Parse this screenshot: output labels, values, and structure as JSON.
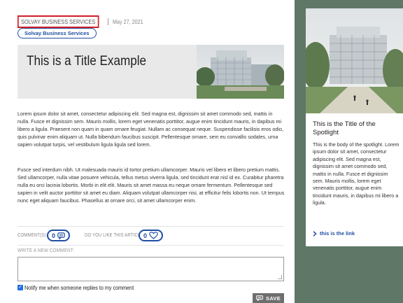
{
  "article": {
    "source": "SOLVAY BUSINESS SERVICES",
    "date": "May 27, 2021",
    "tag": "Solvay Business Services",
    "title": "This is a Title Example",
    "paragraph1": "Lorem ipsum dolor sit amet, consectetur adipiscing elit. Sed magna est, dignissim sit amet commodo sed, mattis in nulla. Fusce et dignissim sem. Mauris mollis, lorem eget venenatis porttitor, augue enim tincidunt mauris, in dapibus mi libero a ligula. Praesent non quam in quam ornare feugiat. Nullam ac consequat neque. Suspendisse facilisis eros odio, quis pulvinar enim aliquam ut. Nulla bibendum faucibus suscipit. Pellentesque ornare, sem eu convallis sodales, urna sapien volutpat turpis, vel vestibulum ligula ligula sed lorem.",
    "paragraph2": "Fusce sed interdum nibh. Ut malesuada mauris id tortor pretium ullamcorper. Mauris vel libero et libero pretium mattis. Sed ullamcorper, nulla vitae posuere vehicula, tellus metus viverra ligula, sed tincidunt erat nisl id ex. Curabitur pharetra nulla eu orci lacinia lobortis. Morbi in elit elit. Mauris sit amet massa eu neque ornare fermentum. Pellentesque sed sapien in velit auctor porttitor sit amet eu diam. Aliquam volutpat ullamcorper nisi, at efficitur felis lobortis non. Ut tempus nunc eget aliquam faucibus. Phasellus at ornare orci, sit amet ullamcorper enim."
  },
  "engagement": {
    "comments_label": "COMMENT(S):",
    "comments_count": "0",
    "like_label": "DO YOU LIKE THIS ARTICLE:",
    "like_count": "0"
  },
  "comment_form": {
    "label": "WRITE A NEW COMMENT:",
    "value": "",
    "notify_label": "Notify me when someone replies to my comment",
    "notify_checked": true,
    "save_label": "SAVE"
  },
  "spotlight": {
    "title": "This is the Title of the Spotlight",
    "body": "This is the body of the spotlight. Lorem ipsum dolor sit amet, consectetur adipiscing elit. Sed magna est, dignissim sit amet commodo sed, mattis in nulla. Fusce et dignissim sem. Mauris mollis, lorem eget venenatis porttitor, augue enim tincidunt mauris, in dapibus mi libero a ligula.",
    "link": "this is the link",
    "link_icon": "chevron-right-icon"
  },
  "colors": {
    "accent": "#1f4fa3",
    "highlight_border": "#d0202a",
    "background": "#5f7766",
    "save_button": "#6e6e6e"
  }
}
